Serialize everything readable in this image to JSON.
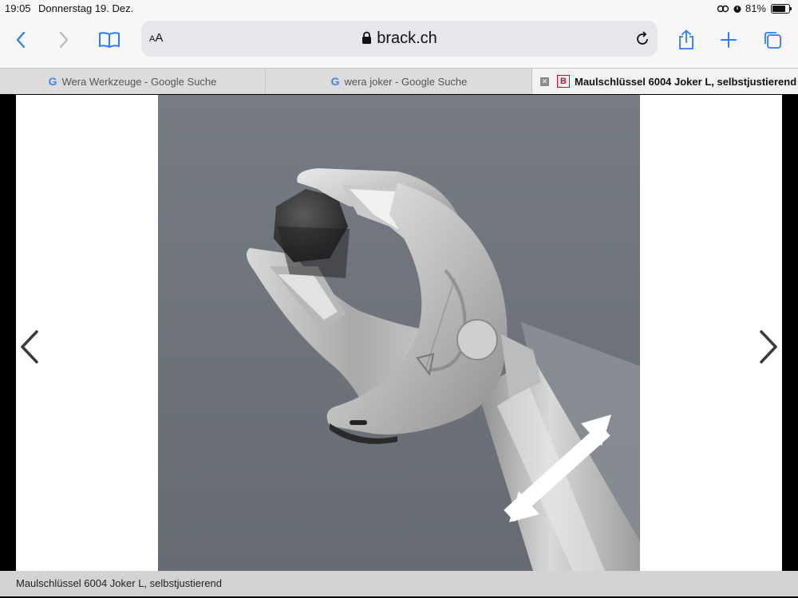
{
  "status_bar": {
    "time": "19:05",
    "date": "Donnerstag 19. Dez.",
    "battery_percent": "81%",
    "battery_level": 0.81
  },
  "toolbar": {
    "reader_label_small": "A",
    "reader_label_large": "A",
    "url": "brack.ch",
    "icons": [
      "back-icon",
      "forward-icon",
      "bookmarks-icon",
      "lock-icon",
      "reload-icon",
      "share-icon",
      "new-tab-icon",
      "tabs-icon"
    ]
  },
  "tabs": [
    {
      "label": "Wera Werkzeuge - Google Suche",
      "favicon": "G",
      "active": false
    },
    {
      "label": "wera joker - Google Suche",
      "favicon": "G",
      "active": false
    },
    {
      "label": "Maulschlüssel 6004 Joker L, selbstjustierend",
      "favicon": "B",
      "active": true
    }
  ],
  "gallery": {
    "image_subject": "self-adjusting open-end wrench",
    "prev_icon": "chevron-left-icon",
    "next_icon": "chevron-right-icon"
  },
  "caption": "Maulschlüssel 6004 Joker L, selbstjustierend",
  "colors": {
    "chrome_bg": "#f7f7f7",
    "address_bg": "#e6e6eb",
    "accent_blue": "#2f7cf6",
    "photo_bg": "#6b7079",
    "caption_bg": "#d3d3d3"
  }
}
